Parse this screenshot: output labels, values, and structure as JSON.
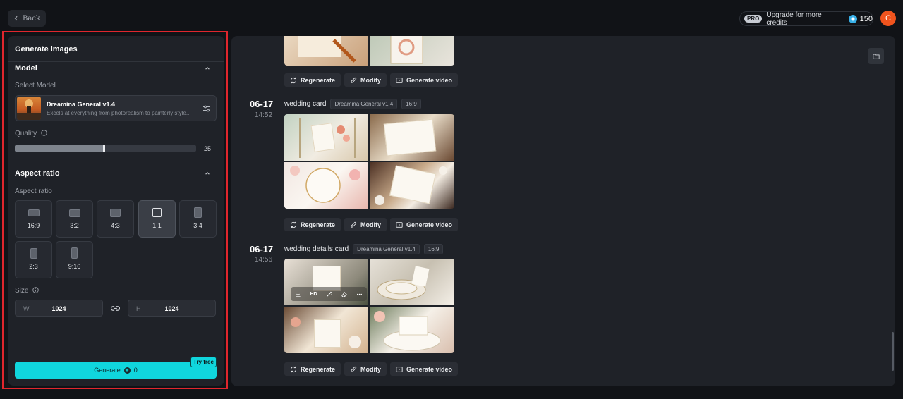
{
  "topbar": {
    "back_label": "Back",
    "pro_badge": "PRO",
    "upgrade_label": "Upgrade for more credits",
    "credits": "150",
    "avatar_initial": "C"
  },
  "panel": {
    "title": "Generate images",
    "model_section": "Model",
    "select_model_label": "Select Model",
    "model_name": "Dreamina General v1.4",
    "model_desc": "Excels at everything from photorealism to painterly style...",
    "quality_label": "Quality",
    "quality_value": "25",
    "quality_fill_fraction": 0.49,
    "aspect_section": "Aspect ratio",
    "aspect_label": "Aspect ratio",
    "ratios": [
      "16:9",
      "3:2",
      "4:3",
      "1:1",
      "3:4",
      "2:3",
      "9:16"
    ],
    "selected_ratio": "1:1",
    "size_label": "Size",
    "width_letter": "W",
    "width_value": "1024",
    "height_letter": "H",
    "height_value": "1024",
    "generate_label": "Generate",
    "generate_cost": "0",
    "try_free_label": "Try free"
  },
  "history": [
    {
      "actions": [
        "Regenerate",
        "Modify",
        "Generate video"
      ]
    },
    {
      "date": "06-17",
      "time": "14:52",
      "prompt": "wedding card",
      "model_tag": "Dreamina General v1.4",
      "ratio_tag": "16:9",
      "actions": [
        "Regenerate",
        "Modify",
        "Generate video"
      ]
    },
    {
      "date": "06-17",
      "time": "14:56",
      "prompt": "wedding details card",
      "model_tag": "Dreamina General v1.4",
      "ratio_tag": "16:9",
      "hover_hd": "HD",
      "actions": [
        "Regenerate",
        "Modify",
        "Generate video"
      ]
    }
  ],
  "colors": {
    "accent": "#10d6dd",
    "avatar": "#f0541e",
    "highlight_outline": "#e0262d"
  }
}
